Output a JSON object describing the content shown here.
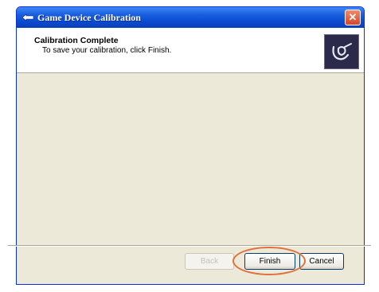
{
  "window": {
    "title": "Game Device Calibration",
    "close_symbol": "✕"
  },
  "header": {
    "title": "Calibration Complete",
    "subtitle": "To save your calibration, click Finish.",
    "image_icon": "game-controller-icon"
  },
  "buttons": {
    "back_label": "Back",
    "finish_label": "Finish",
    "cancel_label": "Cancel"
  },
  "colors": {
    "title_bar": "#0a4bd0",
    "highlight_ring": "#e0703a",
    "window_bg": "#ece9d8"
  }
}
